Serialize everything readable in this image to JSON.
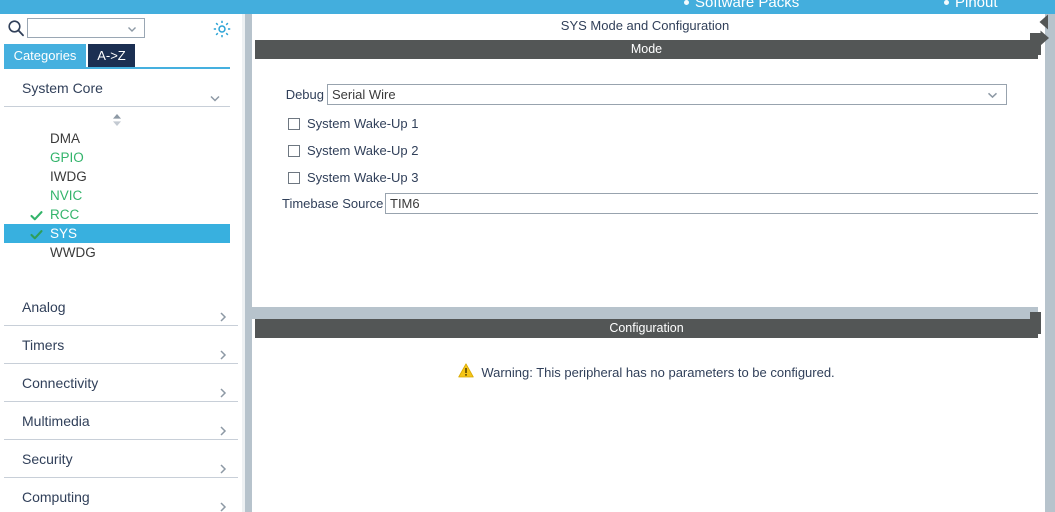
{
  "top_bar": {
    "background": "#43aedd",
    "items": [
      {
        "label": "Software Packs",
        "icon": "bullet-dot"
      },
      {
        "label": "Pinout",
        "icon": "bullet-dot"
      }
    ]
  },
  "sidebar": {
    "search": {
      "value": "",
      "placeholder": "",
      "icon": "search-icon",
      "dropdown_icon": "chevron-down-icon"
    },
    "settings_icon": "gear-icon",
    "tabs": [
      {
        "label": "Categories",
        "active": true,
        "color": "#45b0df"
      },
      {
        "label": "A->Z",
        "active": false,
        "color": "#1b2f52"
      }
    ],
    "expanded_group": {
      "label": "System Core",
      "chevron": "chevron-down-icon",
      "scroll_indicator": "up-down-spinner-icon",
      "peripherals": [
        {
          "label": "DMA",
          "state": "default",
          "checked": false
        },
        {
          "label": "GPIO",
          "state": "configured",
          "checked": false
        },
        {
          "label": "IWDG",
          "state": "default",
          "checked": false
        },
        {
          "label": "NVIC",
          "state": "configured",
          "checked": false
        },
        {
          "label": "RCC",
          "state": "configured",
          "checked": true
        },
        {
          "label": "SYS",
          "state": "selected",
          "checked": true
        },
        {
          "label": "WWDG",
          "state": "default",
          "checked": false
        }
      ]
    },
    "groups": [
      {
        "label": "Analog",
        "chevron": "chevron-right-icon"
      },
      {
        "label": "Timers",
        "chevron": "chevron-right-icon"
      },
      {
        "label": "Connectivity",
        "chevron": "chevron-right-icon"
      },
      {
        "label": "Multimedia",
        "chevron": "chevron-right-icon"
      },
      {
        "label": "Security",
        "chevron": "chevron-right-icon"
      },
      {
        "label": "Computing",
        "chevron": "chevron-right-icon"
      }
    ]
  },
  "main": {
    "panel_title": "SYS Mode and Configuration",
    "mode": {
      "header": "Mode",
      "debug": {
        "label": "Debug",
        "value": "Serial Wire",
        "chevron": "chevron-down-icon"
      },
      "checkboxes": [
        {
          "label": "System Wake-Up 1",
          "checked": false
        },
        {
          "label": "System Wake-Up 2",
          "checked": false
        },
        {
          "label": "System Wake-Up 3",
          "checked": false
        }
      ],
      "timebase": {
        "label": "Timebase Source",
        "value": "TIM6",
        "chevron": "chevron-down-icon"
      }
    },
    "configuration": {
      "header": "Configuration",
      "warning_icon": "warning-triangle-icon",
      "warning_text": "Warning: This peripheral has no parameters to be configured."
    }
  },
  "right_edge": {
    "nav_back_icon": "triangle-left-icon",
    "nav_forward_icon": "triangle-right-icon"
  },
  "colors": {
    "accent_blue": "#43aedd",
    "selection_blue": "#38b0df",
    "dark_navy": "#1b2f52",
    "section_header_gray": "#535656",
    "divider_gray": "#b7c3cc",
    "configured_green": "#33b46b",
    "warning_yellow": "#f5c518",
    "text_slate": "#31405a"
  }
}
